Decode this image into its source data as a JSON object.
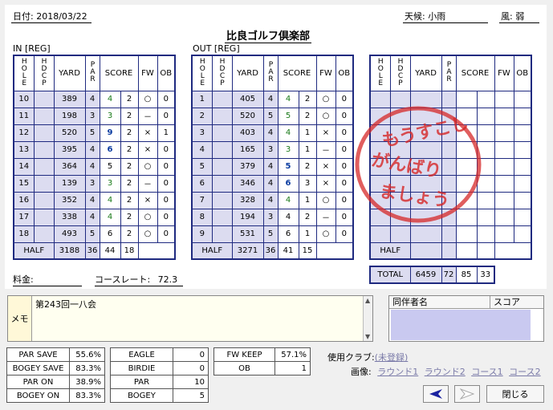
{
  "header": {
    "date_label": "日付: 2018/03/22",
    "weather_label": "天候: 小雨",
    "wind_label": "風: 弱",
    "title": "比良ゴルフ倶楽部"
  },
  "columns": {
    "hole": "HOLE",
    "hdcp": "HDCP",
    "yard": "YARD",
    "par": "PAR",
    "score": "SCORE",
    "fw": "FW",
    "ob": "OB"
  },
  "in_section": {
    "label": "IN [REG]",
    "rows": [
      {
        "hole": "10",
        "yard": "389",
        "par": "4",
        "score": "4",
        "putt": "2",
        "fw": "○",
        "ob": "0"
      },
      {
        "hole": "11",
        "yard": "198",
        "par": "3",
        "score": "3",
        "putt": "2",
        "fw": "－",
        "ob": "0"
      },
      {
        "hole": "12",
        "yard": "520",
        "par": "5",
        "score": "9",
        "putt": "2",
        "fw": "×",
        "ob": "1"
      },
      {
        "hole": "13",
        "yard": "395",
        "par": "4",
        "score": "6",
        "putt": "2",
        "fw": "×",
        "ob": "0"
      },
      {
        "hole": "14",
        "yard": "364",
        "par": "4",
        "score": "5",
        "putt": "2",
        "fw": "○",
        "ob": "0"
      },
      {
        "hole": "15",
        "yard": "139",
        "par": "3",
        "score": "3",
        "putt": "2",
        "fw": "－",
        "ob": "0"
      },
      {
        "hole": "16",
        "yard": "352",
        "par": "4",
        "score": "4",
        "putt": "2",
        "fw": "×",
        "ob": "0"
      },
      {
        "hole": "17",
        "yard": "338",
        "par": "4",
        "score": "4",
        "putt": "2",
        "fw": "○",
        "ob": "0"
      },
      {
        "hole": "18",
        "yard": "493",
        "par": "5",
        "score": "6",
        "putt": "2",
        "fw": "○",
        "ob": "0"
      }
    ],
    "half": {
      "label": "HALF",
      "yard": "3188",
      "par": "36",
      "score": "44",
      "putt": "18"
    }
  },
  "out_section": {
    "label": "OUT [REG]",
    "rows": [
      {
        "hole": "1",
        "yard": "405",
        "par": "4",
        "score": "4",
        "putt": "2",
        "fw": "○",
        "ob": "0"
      },
      {
        "hole": "2",
        "yard": "520",
        "par": "5",
        "score": "5",
        "putt": "2",
        "fw": "○",
        "ob": "0"
      },
      {
        "hole": "3",
        "yard": "403",
        "par": "4",
        "score": "4",
        "putt": "1",
        "fw": "×",
        "ob": "0"
      },
      {
        "hole": "4",
        "yard": "165",
        "par": "3",
        "score": "3",
        "putt": "1",
        "fw": "－",
        "ob": "0"
      },
      {
        "hole": "5",
        "yard": "379",
        "par": "4",
        "score": "5",
        "putt": "2",
        "fw": "×",
        "ob": "0"
      },
      {
        "hole": "6",
        "yard": "346",
        "par": "4",
        "score": "6",
        "putt": "3",
        "fw": "×",
        "ob": "0"
      },
      {
        "hole": "7",
        "yard": "328",
        "par": "4",
        "score": "4",
        "putt": "1",
        "fw": "○",
        "ob": "0"
      },
      {
        "hole": "8",
        "yard": "194",
        "par": "3",
        "score": "4",
        "putt": "2",
        "fw": "－",
        "ob": "0"
      },
      {
        "hole": "9",
        "yard": "531",
        "par": "5",
        "score": "6",
        "putt": "1",
        "fw": "○",
        "ob": "0"
      }
    ],
    "half": {
      "label": "HALF",
      "yard": "3271",
      "par": "36",
      "score": "41",
      "putt": "15"
    }
  },
  "third_section": {
    "half_label": "HALF",
    "total": {
      "label": "TOTAL",
      "yard": "6459",
      "par": "72",
      "score": "85",
      "putt": "33"
    }
  },
  "stamp": {
    "lines": [
      "もうすこし",
      "がんばり",
      "ましょう"
    ]
  },
  "fee_label": "料金:",
  "course_rate": {
    "label": "コースレート:",
    "value": "72.3"
  },
  "memo": {
    "label": "メモ",
    "text": "第243回一八会"
  },
  "companions": {
    "name_header": "同伴者名",
    "score_header": "スコア"
  },
  "stats": {
    "group1": [
      {
        "label": "PAR SAVE",
        "value": "55.6%"
      },
      {
        "label": "BOGEY SAVE",
        "value": "83.3%"
      },
      {
        "label": "PAR ON",
        "value": "38.9%"
      },
      {
        "label": "BOGEY ON",
        "value": "83.3%"
      }
    ],
    "group2": [
      {
        "label": "EAGLE",
        "value": "0"
      },
      {
        "label": "BIRDIE",
        "value": "0"
      },
      {
        "label": "PAR",
        "value": "10"
      },
      {
        "label": "BOGEY",
        "value": "5"
      }
    ],
    "group3": [
      {
        "label": "FW KEEP",
        "value": "57.1%"
      },
      {
        "label": "OB",
        "value": "1"
      }
    ]
  },
  "clubs": {
    "label": "使用クラブ:",
    "value": "(未登録)"
  },
  "images": {
    "label": "画像:",
    "links": [
      "ラウンド1",
      "ラウンド2",
      "コース1",
      "コース2"
    ]
  },
  "buttons": {
    "close": "閉じる"
  },
  "colors": {
    "grid": "#1f2a80",
    "stamp": "#d62828",
    "companion_bg": "#c9c9f0"
  }
}
